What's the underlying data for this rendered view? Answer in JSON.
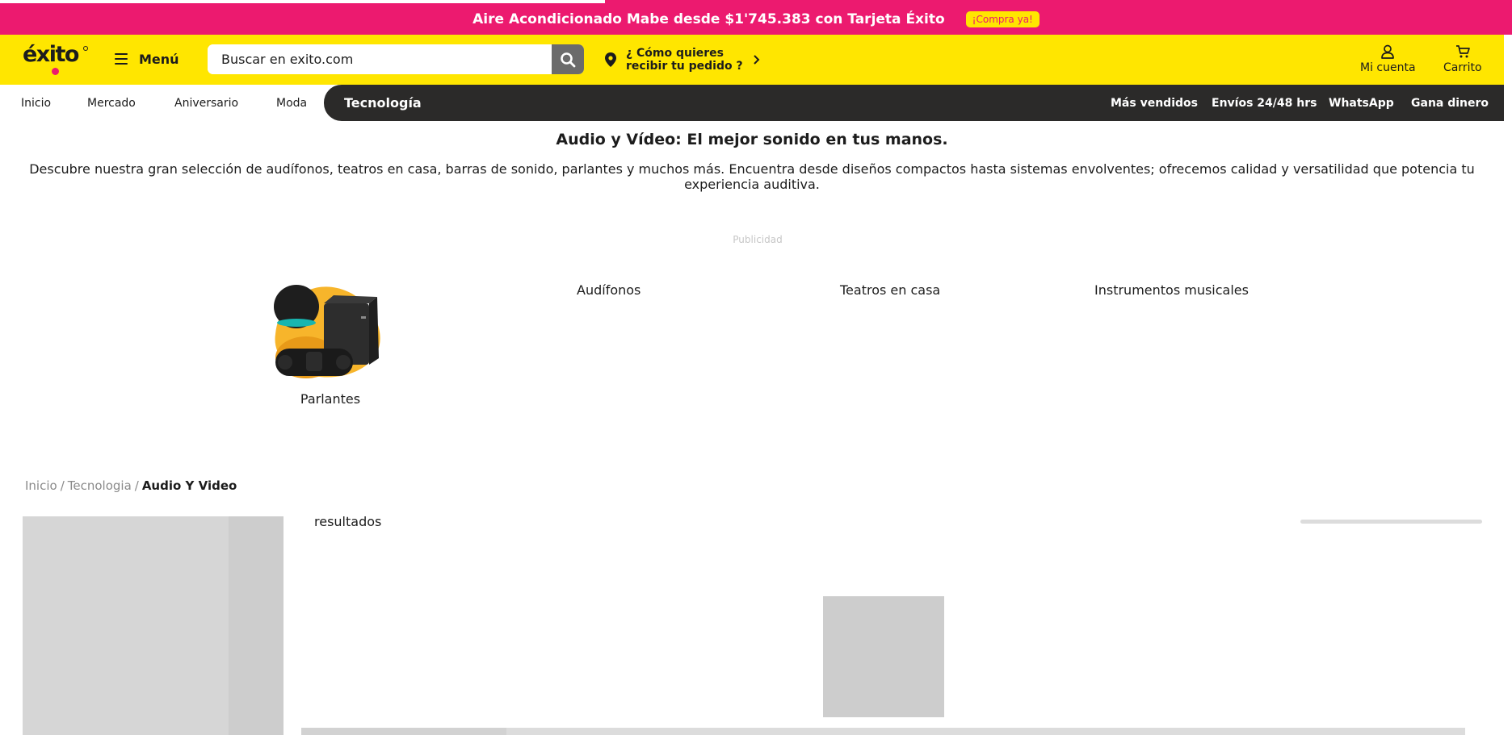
{
  "promo": {
    "text": "Aire Acondicionado Mabe desde $1'745.383 con Tarjeta Éxito",
    "cta": "¡Compra ya!",
    "progress": 0.4
  },
  "header": {
    "logo": "éxito",
    "menu_label": "Menú",
    "search_placeholder": "Buscar en exito.com",
    "delivery_line1": "¿ Cómo quieres",
    "delivery_line2": "recibir tu pedido ?",
    "account_label": "Mi cuenta",
    "cart_label": "Carrito"
  },
  "nav": {
    "items": [
      "Inicio",
      "Mercado",
      "Aniversario",
      "Moda",
      "Tecnología"
    ],
    "active": "Tecnología",
    "right_items": [
      "Más vendidos",
      "Envíos 24/48 hrs",
      "WhatsApp",
      "Gana dinero"
    ]
  },
  "category": {
    "title": "Audio y Vídeo: El mejor sonido en tus manos.",
    "description": "Descubre nuestra gran selección de audífonos, teatros en casa, barras de sonido, parlantes y muchos más. Encuentra desde diseños compactos hasta sistemas envolventes; ofrecemos calidad y versatilidad que potencia tu experiencia auditiva.",
    "ad_label": "Publicidad"
  },
  "subcategories": [
    {
      "label": "Parlantes",
      "icon": "speakers-image"
    },
    {
      "label": "Audífonos"
    },
    {
      "label": "Teatros en casa"
    },
    {
      "label": "Instrumentos musicales"
    }
  ],
  "breadcrumb": {
    "items": [
      "Inicio",
      "Tecnologia"
    ],
    "current": "Audio Y Video"
  },
  "results": {
    "label": "resultados"
  },
  "colors": {
    "promo_bg": "#ec1a6f",
    "header_bg": "#ffe600",
    "nav_dark": "#2b2a29",
    "text": "#1c1c1c"
  }
}
